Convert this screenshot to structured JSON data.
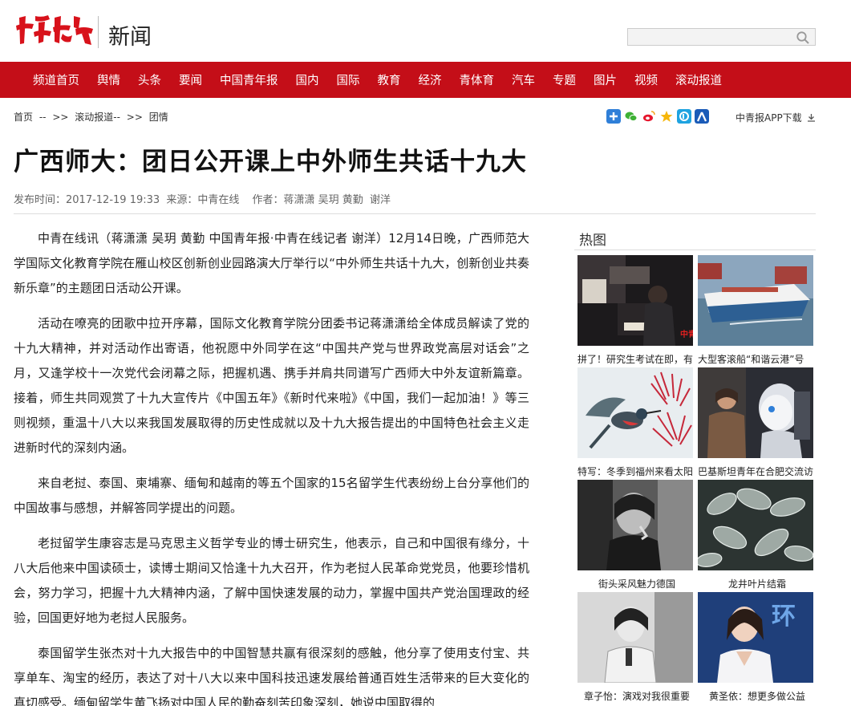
{
  "header": {
    "logo_text": "中青在线",
    "section_name": "新闻",
    "search_placeholder": ""
  },
  "nav": {
    "items": [
      "频道首页",
      "舆情",
      "头条",
      "要闻",
      "中国青年报",
      "国内",
      "国际",
      "教育",
      "经济",
      "青体育",
      "汽车",
      "专题",
      "图片",
      "视频",
      "滚动报道"
    ]
  },
  "breadcrumb": {
    "home": "首页",
    "sep1": "--",
    "arrow1": ">>",
    "level2": "滚动报道--",
    "arrow2": ">>",
    "level3": "团情"
  },
  "share_icons": [
    "plus-share-icon",
    "wechat-icon",
    "weibo-icon",
    "qzone-icon",
    "pengyou-icon",
    "renren-icon"
  ],
  "app_download": "中青报APP下载",
  "article": {
    "title": "广西师大：团日公开课上中外师生共话十九大",
    "meta_publish_label": "发布时间：",
    "meta_publish_time": "2017-12-19 19:33",
    "meta_source_label": "来源：",
    "meta_source": "中青在线",
    "meta_author_label": "作者：",
    "meta_authors": "蒋潇潇 吴玥 黄勤  谢洋",
    "paragraphs": [
      "中青在线讯（蒋潇潇 吴玥 黄勤  中国青年报·中青在线记者  谢洋）12月14日晚，广西师范大学国际文化教育学院在雁山校区创新创业园路演大厅举行以“中外师生共话十九大，创新创业共奏新乐章”的主题团日活动公开课。",
      "活动在嘹亮的团歌中拉开序幕，国际文化教育学院分团委书记蒋潇潇给全体成员解读了党的十九大精神，并对活动作出寄语，他祝愿中外同学在这“中国共产党与世界政党高层对话会”之月，又逢学校十一次党代会闭幕之际，把握机遇、携手并肩共同谱写广西师大中外友谊新篇章。接着，师生共同观赏了十九大宣传片《中国五年》《新时代来啦》《中国，我们一起加油！》等三则视频，重温十八大以来我国发展取得的历史性成就以及十九大报告提出的中国特色社会主义走进新时代的深刻内涵。",
      "来自老挝、泰国、柬埔寨、缅甸和越南的等五个国家的15名留学生代表纷纷上台分享他们的中国故事与感想，并解答同学提出的问题。",
      "老挝留学生康容志是马克思主义哲学专业的博士研究生，他表示，自己和中国很有缘分，十八大后他来中国读硕士，读博士期间又恰逢十九大召开，作为老挝人民革命党党员，他要珍惜机会，努力学习，把握十九大精神内涵，了解中国快速发展的动力，掌握中国共产党治国理政的经验，回国更好地为老挝人民服务。",
      "泰国留学生张杰对十九大报告中的中国智慧共赢有很深刻的感触，他分享了使用支付宝、共享单车、淘宝的经历，表达了对十八大以来中国科技迅速发展给普通百姓生活带来的巨大变化的真切感受。缅甸留学生黄飞扬对中国人民的勤奋刻苦印象深刻，她说中国取得的"
    ]
  },
  "sidebar": {
    "heading": "热图",
    "tiles": [
      {
        "caption": "拼了！研究生考试在即，有",
        "picture": "study-room-photo"
      },
      {
        "caption": "大型客滚船“和谐云港”号",
        "picture": "ferry-photo"
      },
      {
        "caption": "特写：冬季到福州来看太阳",
        "picture": "sunbird-photo"
      },
      {
        "caption": "巴基斯坦青年在合肥交流访",
        "picture": "robot-photo"
      },
      {
        "caption": "街头采风魅力德国",
        "picture": "street-bw-photo"
      },
      {
        "caption": "龙井叶片结霜",
        "picture": "frost-leaves-photo"
      },
      {
        "caption": "章子怡：演戏对我很重要",
        "picture": "actress-bw-photo"
      },
      {
        "caption": "黄圣依：想更多做公益",
        "picture": "actress-color-photo"
      }
    ]
  },
  "colors": {
    "brand_red": "#c40e18",
    "nav_text": "#ffffff"
  }
}
